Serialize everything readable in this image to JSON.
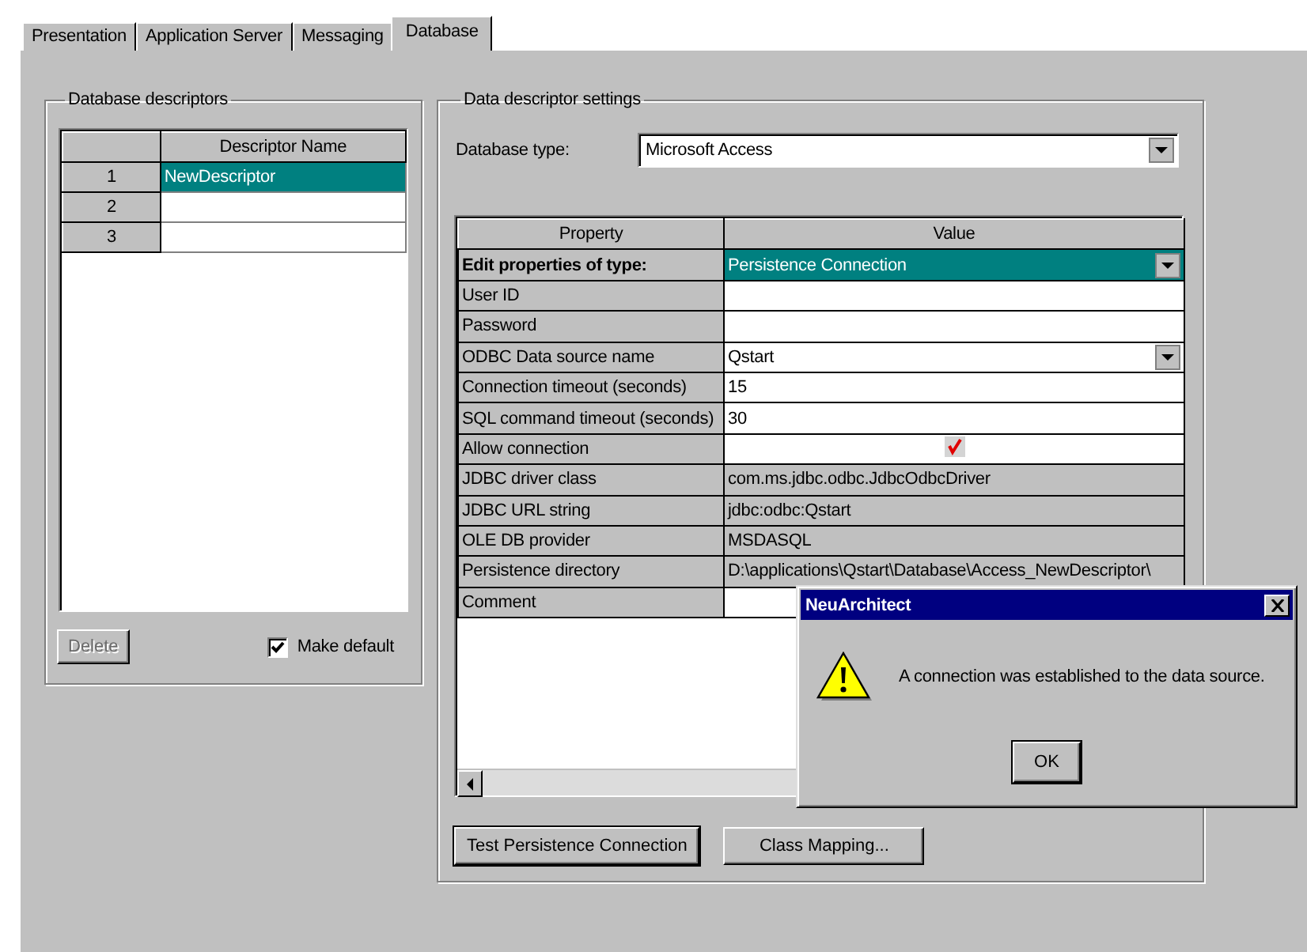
{
  "tabs": [
    {
      "label": "Presentation",
      "selected": false
    },
    {
      "label": "Application Server",
      "selected": false
    },
    {
      "label": "Messaging",
      "selected": false
    },
    {
      "label": "Database",
      "selected": true
    }
  ],
  "descriptors": {
    "title": "Database descriptors",
    "column": "Descriptor Name",
    "rows": [
      {
        "number": "1",
        "name": "NewDescriptor",
        "selected": true
      },
      {
        "number": "2",
        "selected": false
      },
      {
        "number": "3",
        "selected": false
      }
    ],
    "delete_button": {
      "label": "Delete",
      "disabled": true
    },
    "make_default": {
      "label": "Make default",
      "checked": true
    }
  },
  "settings": {
    "title": "Data descriptor settings",
    "database_type": {
      "label": "Database type:",
      "value": "Microsoft Access"
    },
    "columns": [
      "Property",
      "Value"
    ],
    "rows": [
      {
        "property": "Edit properties of type:",
        "value": "Persistence Connection",
        "kind": "type",
        "selected": true
      },
      {
        "property": "User ID",
        "kind": "text",
        "selected": false
      },
      {
        "property": "Password",
        "kind": "text",
        "selected": false
      },
      {
        "property": "ODBC Data source name",
        "value": "Qstart",
        "kind": "combo",
        "selected": false
      },
      {
        "property": "Connection timeout (seconds)",
        "value": "15",
        "kind": "text",
        "selected": false
      },
      {
        "property": "SQL command timeout (seconds)",
        "value": "30",
        "kind": "text",
        "selected": false
      },
      {
        "property": "Allow connection",
        "kind": "checkbox",
        "checked": true,
        "selected": false
      },
      {
        "property": "JDBC driver class",
        "value": "com.ms.jdbc.odbc.JdbcOdbcDriver",
        "kind": "readonly",
        "selected": false
      },
      {
        "property": "JDBC URL string",
        "value": "jdbc:odbc:Qstart",
        "kind": "readonly",
        "selected": false
      },
      {
        "property": "OLE DB provider",
        "value": "MSDASQL",
        "kind": "readonly",
        "selected": false
      },
      {
        "property": "Persistence directory",
        "value": "D:\\applications\\Qstart\\Database\\Access_NewDescriptor\\",
        "kind": "readonly",
        "selected": false
      },
      {
        "property": "Comment",
        "kind": "text",
        "selected": false
      }
    ],
    "buttons": [
      {
        "label": "Test Persistence Connection",
        "default": true
      },
      {
        "label": "Class Mapping...",
        "default": false
      }
    ]
  },
  "dialog": {
    "title": "NeuArchitect",
    "message": "A connection was established to the data source.",
    "button": "OK"
  }
}
